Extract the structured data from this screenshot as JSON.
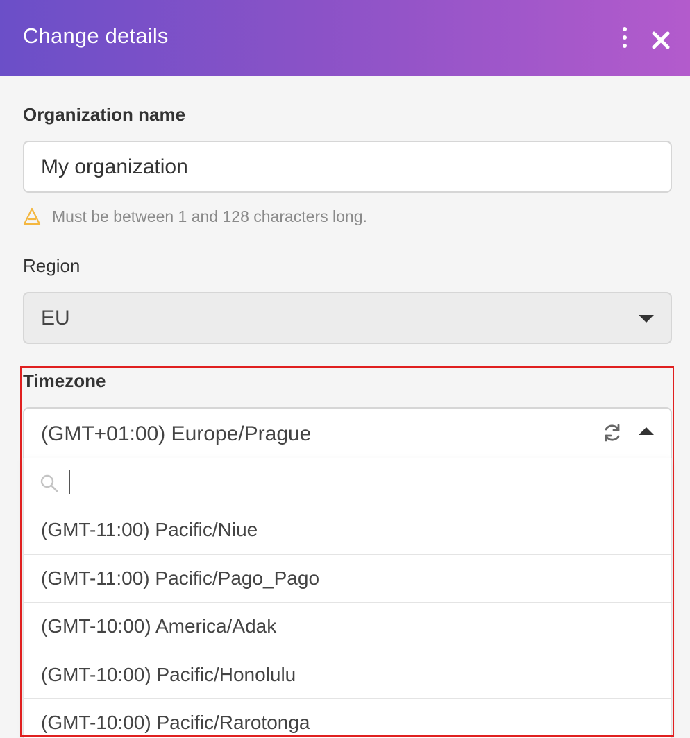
{
  "dialog": {
    "title": "Change details",
    "accent_gradient": [
      "#6b4fc8",
      "#b35bcc"
    ],
    "icons": {
      "menu": "more-vertical-icon",
      "close": "close-icon"
    }
  },
  "organization": {
    "label": "Organization name",
    "value": "My organization",
    "hint": "Must be between 1 and 128 characters long.",
    "hint_icon": "warning-icon"
  },
  "region": {
    "label": "Region",
    "value": "EU"
  },
  "timezone": {
    "label": "Timezone",
    "value": "(GMT+01:00) Europe/Prague",
    "search_placeholder": "",
    "options": [
      "(GMT-11:00) Pacific/Niue",
      "(GMT-11:00) Pacific/Pago_Pago",
      "(GMT-10:00) America/Adak",
      "(GMT-10:00) Pacific/Honolulu",
      "(GMT-10:00) Pacific/Rarotonga"
    ]
  }
}
